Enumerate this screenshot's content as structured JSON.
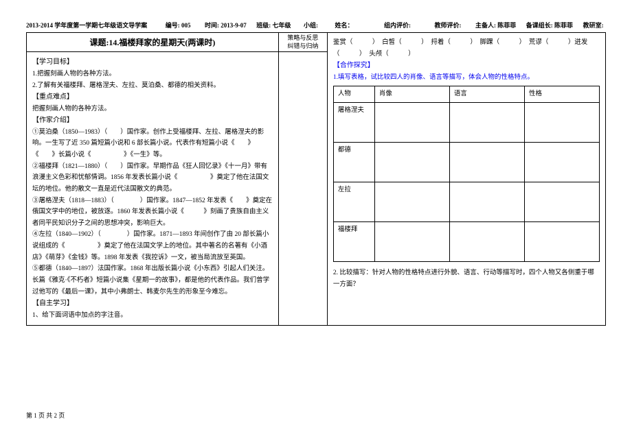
{
  "header": {
    "semester": "2013-2014 学年度第一学期七年级语文导学案",
    "code_label": "编号:",
    "code": "005",
    "time_label": "时间:",
    "time": "2013-9-07",
    "grade_label": "班级:",
    "grade": "七年级",
    "group_label": "小组:",
    "name_label": "姓名：",
    "group_eval_label": "组内评价:",
    "teacher_eval_label": "教师评价:",
    "preparer_label": "主备人:",
    "preparer": "陈菲菲",
    "bk_label": "备课组长:",
    "bk": "陈菲菲",
    "jy_label": "教研室:"
  },
  "title": "课题:14.福楼拜家的星期天(两课时)",
  "side_header_1": "策略与反思",
  "side_header_2": "纠错与归纳",
  "left": {
    "h_objectives": "【学习目标】",
    "obj1": "1.把握刻画人物的各种方法。",
    "obj2": "2.了解有关福楼拜、屠格涅夫、左拉、莫泊桑、都德的相关资料。",
    "h_key": "【重点难点】",
    "key1": "把握刻画人物的各种方法。",
    "h_author": "【作家介绍】",
    "a1": "①莫泊桑（1850—1983）（　　）国作家。创作上受福楼拜、左拉、屠格涅夫的影响。一生写了近 350 篇短篇小说和 6 部长篇小说。代表作有短篇小说《　　》《　　》长篇小说《　　　　　》《一生》等。",
    "a2": "②福楼拜（1821—1880）（　　）国作家。早期作品《狂人回忆录》《十一月》带有浪漫主义色彩和忧郁情调。1856 年发表长篇小说《　　　　　》奠定了他在法国文坛的地位。他的散文一直是近代法国散文的典范。",
    "a3": "③屠格涅夫（1818—1883）（　　　　）国作家。1847—1852 年发表《　　》奠定在俄国文学中的地位，被放逐。1860 年发表长篇小说《　　　》刻画了贵族自由主义者同平民知识分子之间的思想冲突，影响巨大。",
    "a4": "④左拉（1840—1902）（　　　　）国作家。1871—1893 年间创作了由 20 部长篇小说组成的《　　　　　》奠定了他在法国文学上的地位。其中著名的名著有《小酒店》《萌芽》《金钱》等。1898 年发表《我控诉》一文，被当局流放至英国。",
    "a5": "⑤都德（1840—1897）法国作家。1868 年出版长篇小说《小东西》引起人们关注。长篇《雅克·《不朽者》短篇小说集《星期一的故事》，都是他的代表作品。我们曾学过他写的《最后一课》，其中小弗朗士、韩麦尔先生的形象至今难忘。",
    "h_self": "【自主学习】",
    "self1": "1、给下面词语中加点的字注音。"
  },
  "right": {
    "words_line": "鉴赏（　　　）　白皙（　　　）　捋着（　　　）　脚踝（　　　）　荒谬（　　　）迸发（　　　）　头颅（　　　）",
    "h_coop": "【合作探究】",
    "coop1": "1.填写表格，试比较四人的肖像、语言等描写，体会人物的性格特点。",
    "table": {
      "headers": [
        "人物",
        "肖像",
        "语言",
        "性格"
      ],
      "rows": [
        "屠格涅夫",
        "都德",
        "左拉",
        "福楼拜"
      ]
    },
    "coop2": "2. 比较描写：针对人物的性格特点进行外貌、语言、行动等描写时，四个人物又各侧重于哪一方面？"
  },
  "footer": "第 1 页 共 2 页"
}
